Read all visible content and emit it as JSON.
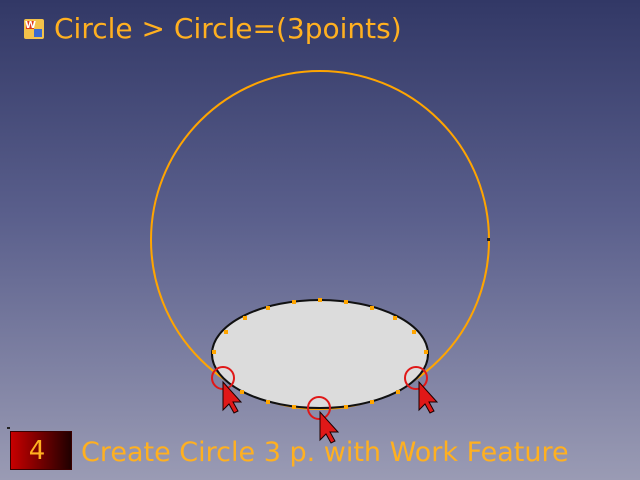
{
  "header": {
    "icon": "workfeature-icon",
    "title": "Circle > Circle=(3points)"
  },
  "footer": {
    "step_number": "4",
    "caption": "Create Circle 3 p. with Work Feature"
  },
  "colors": {
    "accent": "#ffb020",
    "circle": "#ffa500",
    "selection_ring": "#e01818",
    "cursor": "#e01818",
    "surface": "#dcdcdc"
  }
}
